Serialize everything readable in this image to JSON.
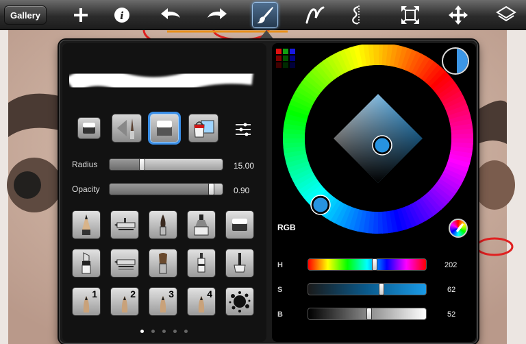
{
  "toolbar": {
    "gallery_label": "Gallery",
    "icons": [
      "add-icon",
      "info-icon",
      "undo-icon",
      "redo-icon",
      "brush-icon",
      "stroke-icon",
      "symmetry-icon",
      "transform-icon",
      "move-icon",
      "layers-icon"
    ]
  },
  "brush_panel": {
    "radius_label": "Radius",
    "radius_value": "15.00",
    "radius_fraction": 0.29,
    "opacity_label": "Opacity",
    "opacity_value": "0.90",
    "opacity_fraction": 0.9,
    "mode_icons": [
      "eraser-mode-icon",
      "smudge-mode-icon",
      "paint-mode-icon",
      "fill-mode-icon",
      "settings-list-icon"
    ],
    "tool_rows": [
      [
        "pencil-icon",
        "airbrush-icon",
        "brush-icon",
        "marker-icon",
        "eraser-icon"
      ],
      [
        "chisel-marker-icon",
        "airbrush-alt-icon",
        "paintbrush-icon",
        "pen-icon",
        "ink-icon"
      ],
      [
        "custom-brush-1-icon",
        "custom-brush-2-icon",
        "custom-brush-3-icon",
        "custom-brush-4-icon",
        "splatter-icon"
      ]
    ],
    "custom_numbers": [
      "1",
      "2",
      "3",
      "4"
    ],
    "page_dots": 5,
    "active_page": 1
  },
  "color_panel": {
    "mode_label": "RGB",
    "current_color": "#3c96e6",
    "swatches": [
      "#e01010",
      "#10a010",
      "#1818e0",
      "#800000",
      "#005500",
      "#000080",
      "#400000",
      "#002a00",
      "#00003a"
    ],
    "h_label": "H",
    "h_value": "202",
    "s_label": "S",
    "s_value": "62",
    "b_label": "B",
    "b_value": "52"
  }
}
